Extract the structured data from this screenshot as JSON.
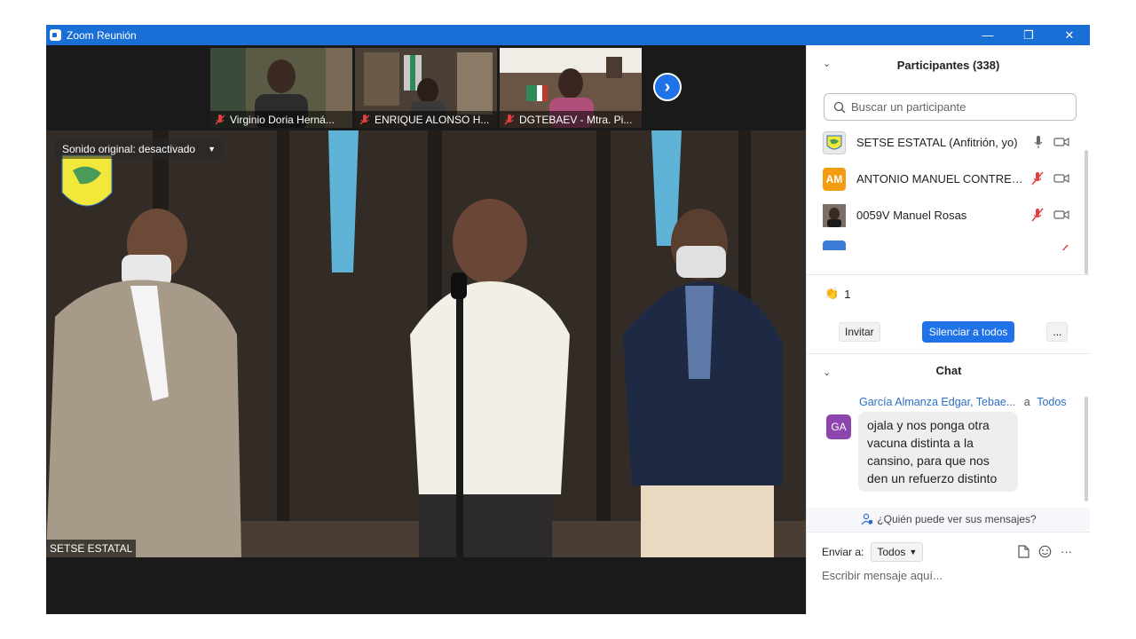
{
  "window": {
    "title": "Zoom Reunión",
    "controls": {
      "minimize": "—",
      "restore": "❐",
      "close": "✕"
    }
  },
  "thumbnails": [
    {
      "name": "Virginio Doria Herná..."
    },
    {
      "name": "ENRIQUE ALONSO H..."
    },
    {
      "name": "DGTEBAEV - Mtra. Pi..."
    }
  ],
  "main_video": {
    "audio_status": "Sonido original: desactivado",
    "speaker_label": "SETSE ESTATAL"
  },
  "participants": {
    "title": "Participantes (338)",
    "search_placeholder": "Buscar un participante",
    "items": [
      {
        "name": "SETSE ESTATAL (Anfitrión, yo)",
        "avatar": "",
        "avatar_color": "#e9e9e9",
        "muted": false
      },
      {
        "name": "ANTONIO MANUEL CONTRER...",
        "avatar": "AM",
        "avatar_color": "#f39c12",
        "muted": true
      },
      {
        "name": "0059V Manuel Rosas",
        "avatar": "",
        "avatar_color": "#5a4a40",
        "muted": true
      },
      {
        "name": "",
        "avatar": "",
        "avatar_color": "#3a7bd5",
        "muted": true
      }
    ],
    "reaction_count": "1",
    "invite_label": "Invitar",
    "mute_all_label": "Silenciar a todos",
    "more_label": "..."
  },
  "chat": {
    "title": "Chat",
    "messages": [
      {
        "sender": "García Almanza Edgar, Tebae...",
        "to_label": "a",
        "to": "Todos",
        "avatar": "GA",
        "text": "ojala y nos ponga otra vacuna distinta a la cansino, para que nos den un refuerzo distinto"
      }
    ],
    "who_can_see": "¿Quién puede ver sus mensajes?",
    "send_to_label": "Enviar a:",
    "send_to_value": "Todos",
    "compose_placeholder": "Escribir mensaje aquí..."
  },
  "colors": {
    "titlebar": "#1a6fd6",
    "accent_blue": "#1f72e8",
    "mute_red": "#e04040",
    "chat_link": "#2d6fc7"
  }
}
